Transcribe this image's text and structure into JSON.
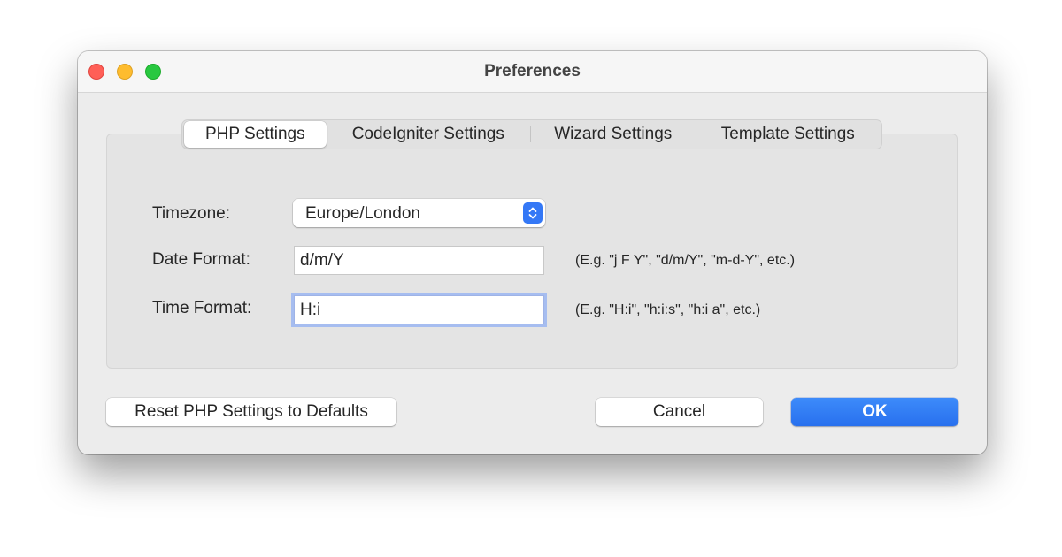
{
  "window": {
    "title": "Preferences"
  },
  "tabs": [
    {
      "label": "PHP Settings",
      "selected": true
    },
    {
      "label": "CodeIgniter Settings",
      "selected": false
    },
    {
      "label": "Wizard Settings",
      "selected": false
    },
    {
      "label": "Template Settings",
      "selected": false
    }
  ],
  "form": {
    "timezone": {
      "label": "Timezone:",
      "value": "Europe/London",
      "control_icon": "up-down-chevrons-icon"
    },
    "date_format": {
      "label": "Date Format:",
      "value": "d/m/Y",
      "hint": "(E.g. \"j F Y\", \"d/m/Y\", \"m-d-Y\", etc.)"
    },
    "time_format": {
      "label": "Time Format:",
      "value": "H:i",
      "hint": "(E.g. \"H:i\", \"h:i:s\", \"h:i a\", etc.)",
      "focused": true
    }
  },
  "buttons": {
    "reset_label": "Reset PHP Settings to Defaults",
    "cancel_label": "Cancel",
    "ok_label": "OK"
  },
  "colors": {
    "accent": "#2b74f3",
    "close": "#ff5f57",
    "minimize": "#febc2e",
    "zoom": "#28c840",
    "focus_ring": "#a6bdf0"
  }
}
